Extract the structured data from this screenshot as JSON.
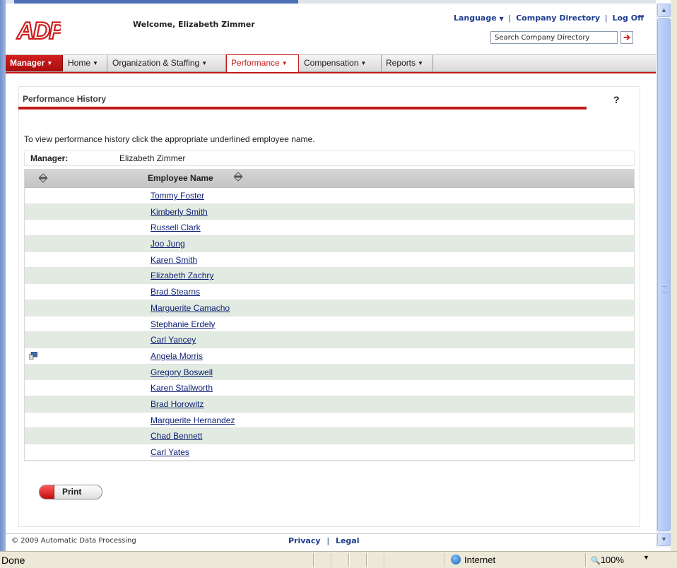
{
  "header": {
    "welcome": "Welcome, Elizabeth Zimmer",
    "language": "Language",
    "company_directory": "Company Directory",
    "log_off": "Log Off",
    "search_placeholder": "Search Company Directory"
  },
  "nav": {
    "manager": "Manager",
    "home": "Home",
    "organization": "Organization & Staffing",
    "performance": "Performance",
    "compensation": "Compensation",
    "reports": "Reports"
  },
  "page": {
    "title": "Performance History",
    "help": "?",
    "intro": "To view performance history click the appropriate underlined employee name.",
    "manager_label": "Manager:",
    "manager_value": "Elizabeth Zimmer",
    "col_employee": "Employee Name",
    "employees": [
      "Tommy Foster",
      "Kimberly Smith",
      "Russell Clark",
      "Joo Jung",
      "Karen Smith",
      "Elizabeth Zachry",
      "Brad Stearns",
      "Marguerite Camacho",
      "Stephanie Erdely",
      "Carl Yancey",
      "Angela Morris",
      "Gregory Boswell",
      "Karen Stallworth",
      "Brad Horowitz",
      "Marguerite Hernandez",
      "Chad Bennett",
      "Carl Yates"
    ],
    "print": "Print"
  },
  "footer": {
    "copyright": "© 2009 Automatic Data Processing",
    "privacy": "Privacy",
    "legal": "Legal"
  },
  "status": {
    "done": "Done",
    "zone": "Internet",
    "zoom": "100%"
  },
  "colors": {
    "brand_red": "#c11a1a",
    "link_blue": "#1f3d8f",
    "row_alt": "#e2ebe1"
  }
}
